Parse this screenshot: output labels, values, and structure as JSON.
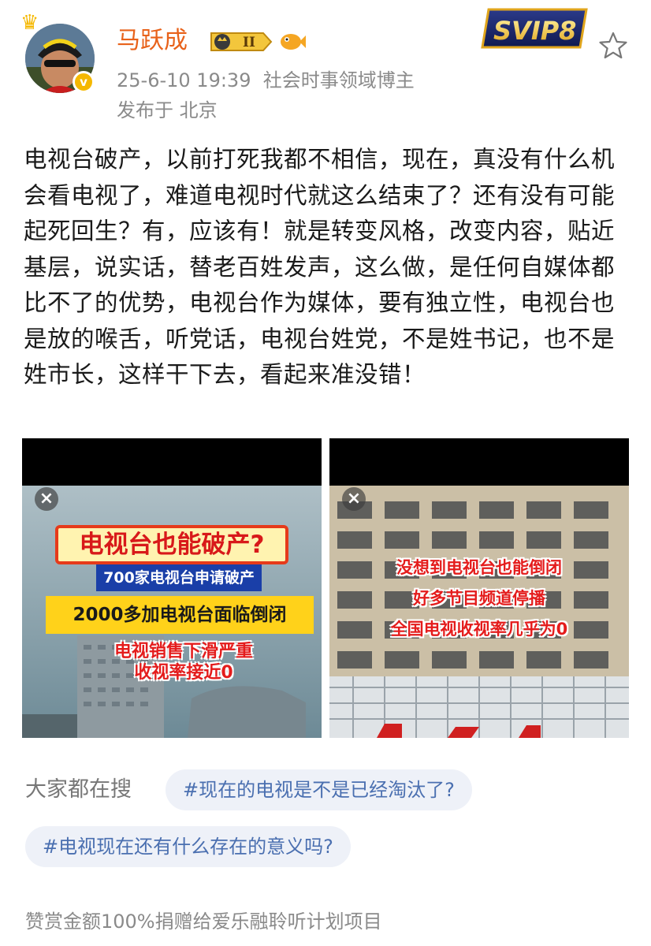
{
  "author": {
    "name": "马跃成",
    "rank_badge": "II",
    "verified_icon": "v-verified-icon",
    "vip_badge": "SVIP8",
    "post_time": "25-6-10 19:39",
    "tag": "社会时事领域博主",
    "location_line": "发布于 北京"
  },
  "post": {
    "text": "电视台破产，以前打死我都不相信，现在，真没有什么机会看电视了，难道电视时代就这么结束了？还有没有可能起死回生？有，应该有！就是转变风格，改变内容，贴近基层，说实话，替老百姓发声，这么做，是任何自媒体都比不了的优势，电视台作为媒体，要有独立性，电视台也是放的喉舌，听党话，电视台姓党，不是姓书记，也不是姓市长，这样干下去，看起来准没错！"
  },
  "image1": {
    "close_label": "×",
    "headline": "电视台也能破产?",
    "blue_banner": "700家电视台申请破产",
    "yellow_banner": "2000多加电视台面临倒闭",
    "red_line1": "电视销售下滑严重",
    "red_line2": "收视率接近0"
  },
  "image2": {
    "close_label": "×",
    "line1": "没想到电视台也能倒闭",
    "line2": "好多节目频道停播",
    "line3": "全国电视收视率几乎为0"
  },
  "search": {
    "label": "大家都在搜",
    "chips": [
      "#现在的电视是不是已经淘汰了?",
      "#电视现在还有什么存在的意义吗?"
    ]
  },
  "footer": {
    "note": "赞赏金额100%捐赠给爱乐融聆听计划项目"
  },
  "colors": {
    "username": "#e8621a",
    "meta_gray": "#8a8a8a",
    "chip_bg": "#eef1f8",
    "chip_text": "#4a6fb0",
    "alert_red": "#e41c1c"
  }
}
